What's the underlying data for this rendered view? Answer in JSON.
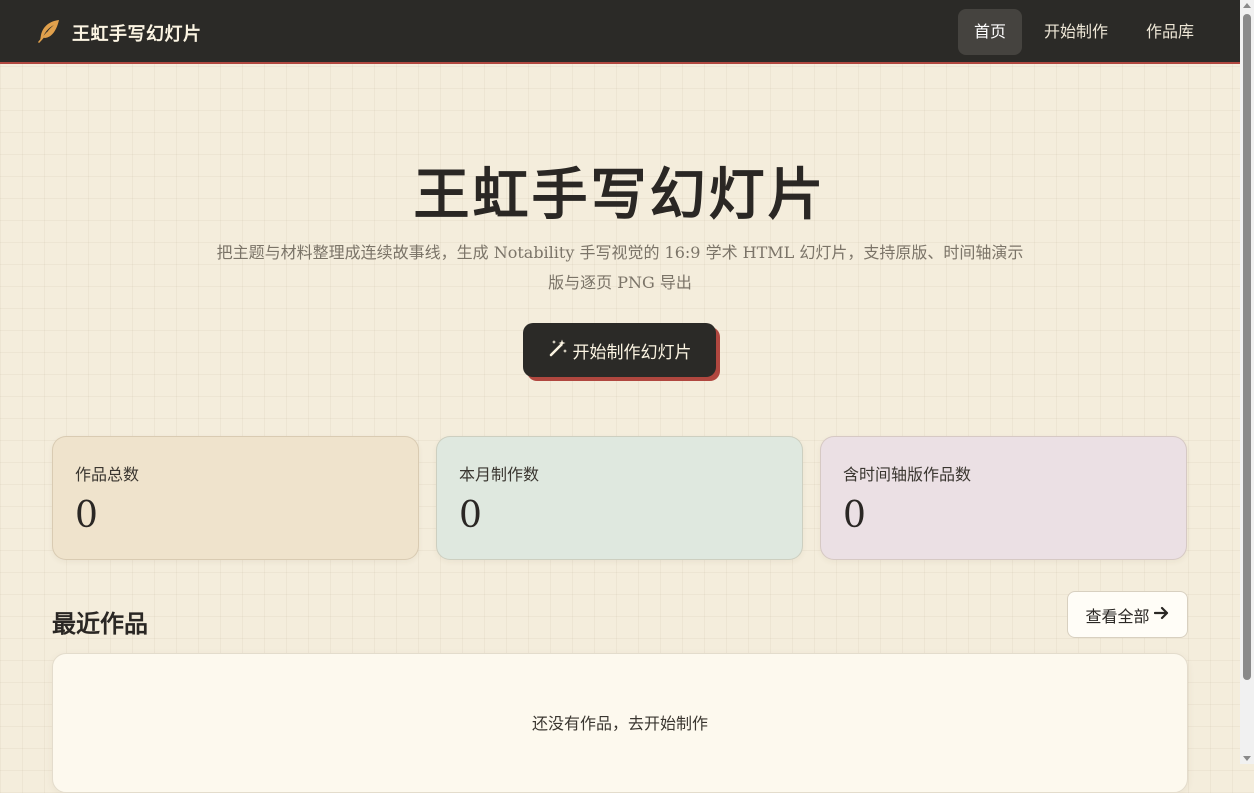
{
  "brand": {
    "name": "王虹手写幻灯片",
    "icon": "feather-icon",
    "icon_color": "#e0a04c"
  },
  "nav": {
    "items": [
      {
        "label": "首页",
        "active": true
      },
      {
        "label": "开始制作",
        "active": false
      },
      {
        "label": "作品库",
        "active": false
      }
    ]
  },
  "hero": {
    "title": "王虹手写幻灯片",
    "subtitle": "把主题与材料整理成连续故事线，生成 Notability 手写视觉的 16:9 学术 HTML 幻灯片，支持原版、时间轴演示版与逐页 PNG 导出",
    "cta_label": "开始制作幻灯片",
    "cta_icon": "magic-wand-icon"
  },
  "stats": [
    {
      "label": "作品总数",
      "value": "0",
      "color": "#efe3cc"
    },
    {
      "label": "本月制作数",
      "value": "0",
      "color": "#dfe8df"
    },
    {
      "label": "含时间轴版作品数",
      "value": "0",
      "color": "#ebe0e4"
    }
  ],
  "recent": {
    "title": "最近作品",
    "view_all_label": "查看全部",
    "view_all_icon": "arrow-right-icon",
    "empty_text": "还没有作品，去开始制作"
  },
  "colors": {
    "accent": "#b0473f",
    "dark": "#2b2a27",
    "background": "#f4eddc"
  }
}
